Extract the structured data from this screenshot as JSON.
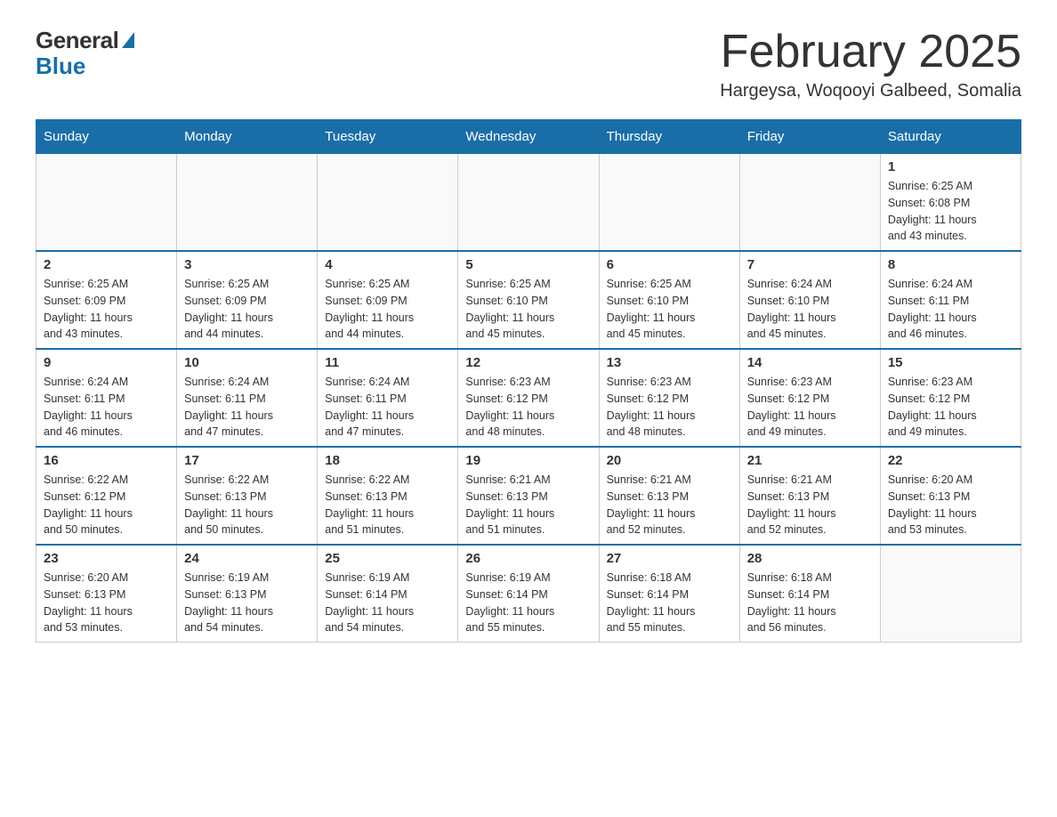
{
  "logo": {
    "general": "General",
    "blue": "Blue"
  },
  "title": "February 2025",
  "location": "Hargeysa, Woqooyi Galbeed, Somalia",
  "days_of_week": [
    "Sunday",
    "Monday",
    "Tuesday",
    "Wednesday",
    "Thursday",
    "Friday",
    "Saturday"
  ],
  "weeks": [
    [
      {
        "day": "",
        "info": ""
      },
      {
        "day": "",
        "info": ""
      },
      {
        "day": "",
        "info": ""
      },
      {
        "day": "",
        "info": ""
      },
      {
        "day": "",
        "info": ""
      },
      {
        "day": "",
        "info": ""
      },
      {
        "day": "1",
        "info": "Sunrise: 6:25 AM\nSunset: 6:08 PM\nDaylight: 11 hours\nand 43 minutes."
      }
    ],
    [
      {
        "day": "2",
        "info": "Sunrise: 6:25 AM\nSunset: 6:09 PM\nDaylight: 11 hours\nand 43 minutes."
      },
      {
        "day": "3",
        "info": "Sunrise: 6:25 AM\nSunset: 6:09 PM\nDaylight: 11 hours\nand 44 minutes."
      },
      {
        "day": "4",
        "info": "Sunrise: 6:25 AM\nSunset: 6:09 PM\nDaylight: 11 hours\nand 44 minutes."
      },
      {
        "day": "5",
        "info": "Sunrise: 6:25 AM\nSunset: 6:10 PM\nDaylight: 11 hours\nand 45 minutes."
      },
      {
        "day": "6",
        "info": "Sunrise: 6:25 AM\nSunset: 6:10 PM\nDaylight: 11 hours\nand 45 minutes."
      },
      {
        "day": "7",
        "info": "Sunrise: 6:24 AM\nSunset: 6:10 PM\nDaylight: 11 hours\nand 45 minutes."
      },
      {
        "day": "8",
        "info": "Sunrise: 6:24 AM\nSunset: 6:11 PM\nDaylight: 11 hours\nand 46 minutes."
      }
    ],
    [
      {
        "day": "9",
        "info": "Sunrise: 6:24 AM\nSunset: 6:11 PM\nDaylight: 11 hours\nand 46 minutes."
      },
      {
        "day": "10",
        "info": "Sunrise: 6:24 AM\nSunset: 6:11 PM\nDaylight: 11 hours\nand 47 minutes."
      },
      {
        "day": "11",
        "info": "Sunrise: 6:24 AM\nSunset: 6:11 PM\nDaylight: 11 hours\nand 47 minutes."
      },
      {
        "day": "12",
        "info": "Sunrise: 6:23 AM\nSunset: 6:12 PM\nDaylight: 11 hours\nand 48 minutes."
      },
      {
        "day": "13",
        "info": "Sunrise: 6:23 AM\nSunset: 6:12 PM\nDaylight: 11 hours\nand 48 minutes."
      },
      {
        "day": "14",
        "info": "Sunrise: 6:23 AM\nSunset: 6:12 PM\nDaylight: 11 hours\nand 49 minutes."
      },
      {
        "day": "15",
        "info": "Sunrise: 6:23 AM\nSunset: 6:12 PM\nDaylight: 11 hours\nand 49 minutes."
      }
    ],
    [
      {
        "day": "16",
        "info": "Sunrise: 6:22 AM\nSunset: 6:12 PM\nDaylight: 11 hours\nand 50 minutes."
      },
      {
        "day": "17",
        "info": "Sunrise: 6:22 AM\nSunset: 6:13 PM\nDaylight: 11 hours\nand 50 minutes."
      },
      {
        "day": "18",
        "info": "Sunrise: 6:22 AM\nSunset: 6:13 PM\nDaylight: 11 hours\nand 51 minutes."
      },
      {
        "day": "19",
        "info": "Sunrise: 6:21 AM\nSunset: 6:13 PM\nDaylight: 11 hours\nand 51 minutes."
      },
      {
        "day": "20",
        "info": "Sunrise: 6:21 AM\nSunset: 6:13 PM\nDaylight: 11 hours\nand 52 minutes."
      },
      {
        "day": "21",
        "info": "Sunrise: 6:21 AM\nSunset: 6:13 PM\nDaylight: 11 hours\nand 52 minutes."
      },
      {
        "day": "22",
        "info": "Sunrise: 6:20 AM\nSunset: 6:13 PM\nDaylight: 11 hours\nand 53 minutes."
      }
    ],
    [
      {
        "day": "23",
        "info": "Sunrise: 6:20 AM\nSunset: 6:13 PM\nDaylight: 11 hours\nand 53 minutes."
      },
      {
        "day": "24",
        "info": "Sunrise: 6:19 AM\nSunset: 6:13 PM\nDaylight: 11 hours\nand 54 minutes."
      },
      {
        "day": "25",
        "info": "Sunrise: 6:19 AM\nSunset: 6:14 PM\nDaylight: 11 hours\nand 54 minutes."
      },
      {
        "day": "26",
        "info": "Sunrise: 6:19 AM\nSunset: 6:14 PM\nDaylight: 11 hours\nand 55 minutes."
      },
      {
        "day": "27",
        "info": "Sunrise: 6:18 AM\nSunset: 6:14 PM\nDaylight: 11 hours\nand 55 minutes."
      },
      {
        "day": "28",
        "info": "Sunrise: 6:18 AM\nSunset: 6:14 PM\nDaylight: 11 hours\nand 56 minutes."
      },
      {
        "day": "",
        "info": ""
      }
    ]
  ]
}
